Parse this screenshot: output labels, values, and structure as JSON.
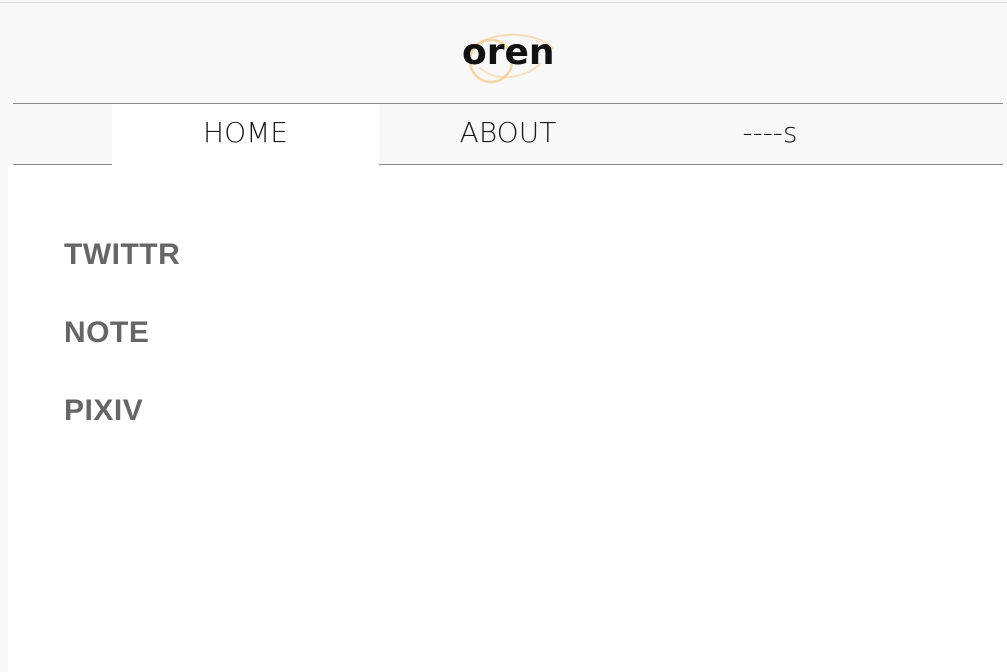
{
  "header": {
    "logo_text": "oren"
  },
  "nav": {
    "tabs": [
      {
        "label": "HOME",
        "active": true
      },
      {
        "label": "ABOUT",
        "active": false
      },
      {
        "label": "----s",
        "active": false
      }
    ]
  },
  "main": {
    "links": [
      {
        "label": "TWITTR"
      },
      {
        "label": "NOTE"
      },
      {
        "label": "PIXIV"
      }
    ]
  },
  "colors": {
    "background": "#f8f8f8",
    "content_background": "#ffffff",
    "link_text": "#666666",
    "logo_accent": "#f5c98a",
    "nav_border": "#8a8a8a"
  }
}
